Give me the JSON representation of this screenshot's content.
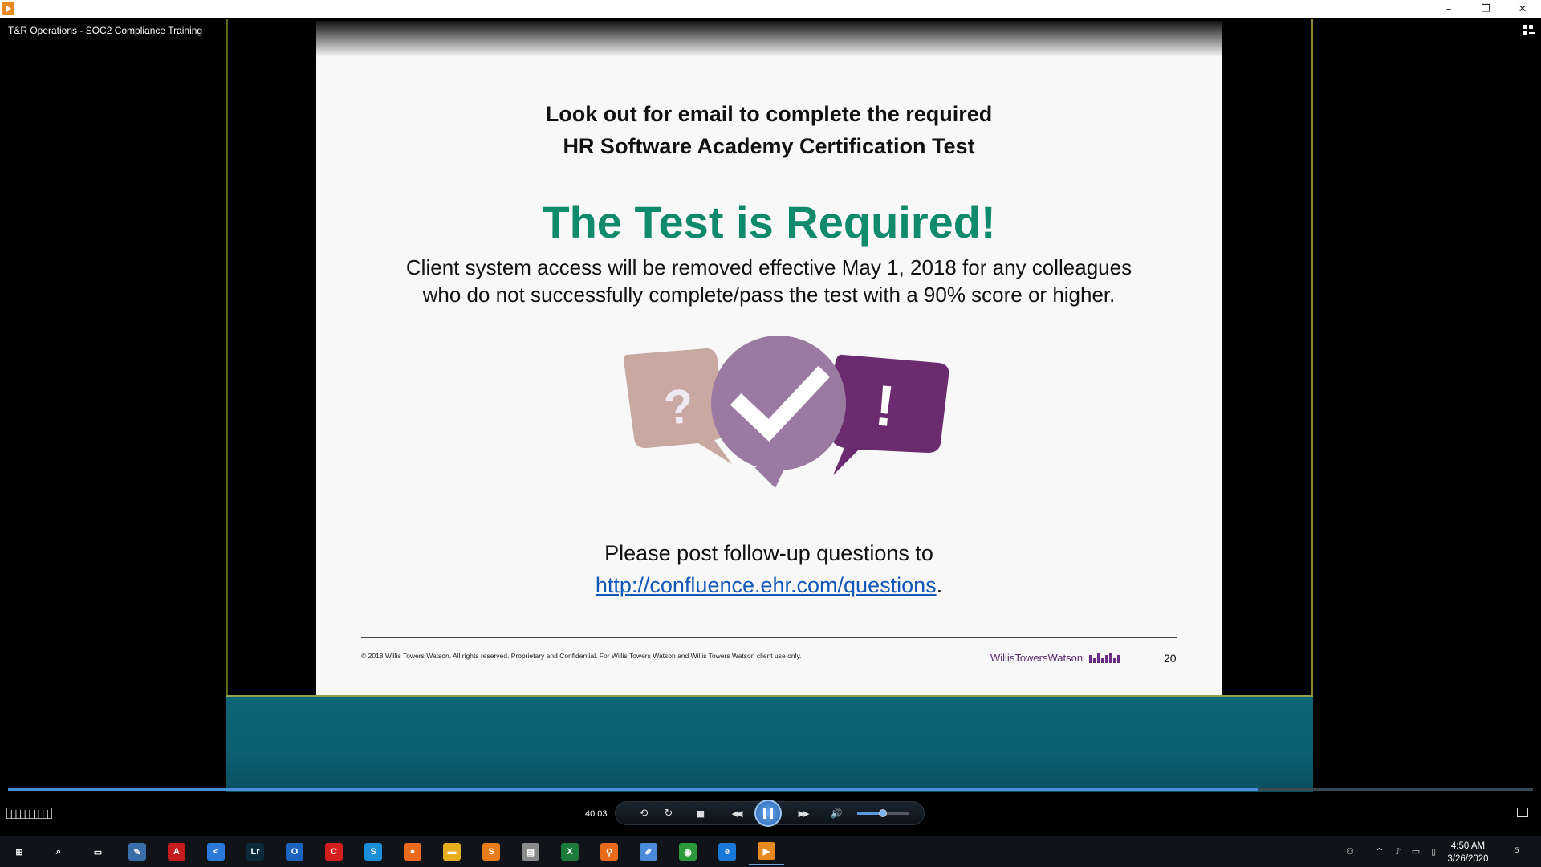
{
  "window": {
    "title": "T&R Operations - SOC2 Compliance Training",
    "controls": {
      "minimize": "–",
      "restore": "❐",
      "close": "✕"
    }
  },
  "slide": {
    "heading_line1": "Look out for email to complete the required",
    "heading_line2": "HR Software Academy Certification Test",
    "required": "The Test is Required!",
    "notice_line1": "Client system access will be removed effective May 1, 2018 for any colleagues",
    "notice_line2": "who do not successfully complete/pass the test with a 90% score or higher.",
    "followup": "Please post follow-up questions to",
    "link": "http://confluence.ehr.com/questions",
    "link_suffix": ".",
    "copyright": "© 2018 Willis Towers Watson. All rights reserved. Proprietary and Confidential. For Willis Towers Watson and Willis Towers Watson client use only.",
    "brand": "WillisTowersWatson",
    "page_number": "20",
    "graphic": {
      "bubble_question": "?",
      "bubble_exclaim": "!",
      "colors": {
        "question": "#c8a8a0",
        "check": "#9a7aa0",
        "exclaim": "#6a2c6e"
      }
    }
  },
  "player": {
    "progress_fraction": 0.82,
    "speed_label": "|||||||||",
    "time": "40:03",
    "volume_fraction": 0.5,
    "buttons": {
      "loop": "⟲",
      "refresh": "↻",
      "stop": "■",
      "rewind": "◀◀",
      "forward": "▶▶",
      "volume": "🔊"
    }
  },
  "taskbar": {
    "clock_time": "4:50 AM",
    "clock_date": "3/26/2020",
    "notification_count": "5",
    "apps": [
      {
        "name": "start",
        "glyph": "⊞",
        "color": "#101418"
      },
      {
        "name": "search",
        "glyph": "⌕",
        "color": "#101418"
      },
      {
        "name": "task-view",
        "glyph": "▭",
        "color": "#101418"
      },
      {
        "name": "paint",
        "glyph": "✎",
        "color": "#3a6ea8"
      },
      {
        "name": "acrobat",
        "glyph": "A",
        "color": "#c41c1c"
      },
      {
        "name": "vscode",
        "glyph": "<",
        "color": "#2a7ad8"
      },
      {
        "name": "lightroom",
        "glyph": "Lr",
        "color": "#0b2a3a"
      },
      {
        "name": "outlook",
        "glyph": "O",
        "color": "#1a64c0"
      },
      {
        "name": "creative-cloud",
        "glyph": "C",
        "color": "#d41f1f"
      },
      {
        "name": "skype",
        "glyph": "S",
        "color": "#1a8ed8"
      },
      {
        "name": "firefox",
        "glyph": "●",
        "color": "#e86a1a"
      },
      {
        "name": "file-explorer",
        "glyph": "▬",
        "color": "#e8b020"
      },
      {
        "name": "sublime",
        "glyph": "S",
        "color": "#e87c1c"
      },
      {
        "name": "printer",
        "glyph": "▤",
        "color": "#8a8a8a"
      },
      {
        "name": "excel",
        "glyph": "X",
        "color": "#1d7a3a"
      },
      {
        "name": "search-tool",
        "glyph": "⚲",
        "color": "#e86a1a"
      },
      {
        "name": "notes",
        "glyph": "✐",
        "color": "#4a8ad8"
      },
      {
        "name": "chrome",
        "glyph": "◉",
        "color": "#2a9a3a"
      },
      {
        "name": "edge",
        "glyph": "e",
        "color": "#1a78d8"
      },
      {
        "name": "media-player",
        "glyph": "▶",
        "color": "#e8891f"
      }
    ]
  }
}
